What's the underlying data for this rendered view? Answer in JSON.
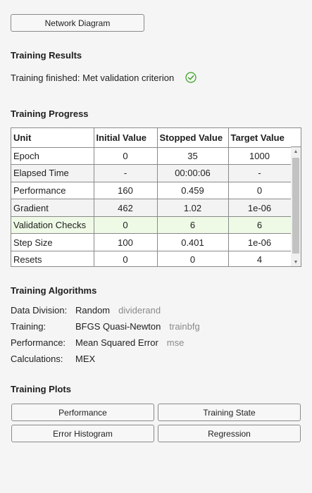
{
  "top_button": "Network Diagram",
  "results": {
    "title": "Training Results",
    "status": "Training finished: Met validation criterion",
    "status_icon": "checkmark-circle-icon",
    "status_color": "#35a11b"
  },
  "progress": {
    "title": "Training Progress",
    "columns": [
      "Unit",
      "Initial Value",
      "Stopped Value",
      "Target Value"
    ],
    "rows": [
      {
        "unit": "Epoch",
        "initial": "0",
        "stopped": "35",
        "target": "1000"
      },
      {
        "unit": "Elapsed Time",
        "initial": "-",
        "stopped": "00:00:06",
        "target": "-"
      },
      {
        "unit": "Performance",
        "initial": "160",
        "stopped": "0.459",
        "target": "0"
      },
      {
        "unit": "Gradient",
        "initial": "462",
        "stopped": "1.02",
        "target": "1e-06"
      },
      {
        "unit": "Validation Checks",
        "initial": "0",
        "stopped": "6",
        "target": "6"
      },
      {
        "unit": "Step Size",
        "initial": "100",
        "stopped": "0.401",
        "target": "1e-06"
      },
      {
        "unit": "Resets",
        "initial": "0",
        "stopped": "0",
        "target": "4"
      }
    ],
    "highlight_color": "#eefae6"
  },
  "algorithms": {
    "title": "Training Algorithms",
    "items": [
      {
        "label": "Data Division:",
        "value": "Random",
        "fn": "dividerand"
      },
      {
        "label": "Training:",
        "value": "BFGS Quasi-Newton",
        "fn": "trainbfg"
      },
      {
        "label": "Performance:",
        "value": "Mean Squared Error",
        "fn": "mse"
      },
      {
        "label": "Calculations:",
        "value": "MEX",
        "fn": ""
      }
    ]
  },
  "plots": {
    "title": "Training Plots",
    "buttons": [
      "Performance",
      "Training State",
      "Error Histogram",
      "Regression"
    ]
  }
}
